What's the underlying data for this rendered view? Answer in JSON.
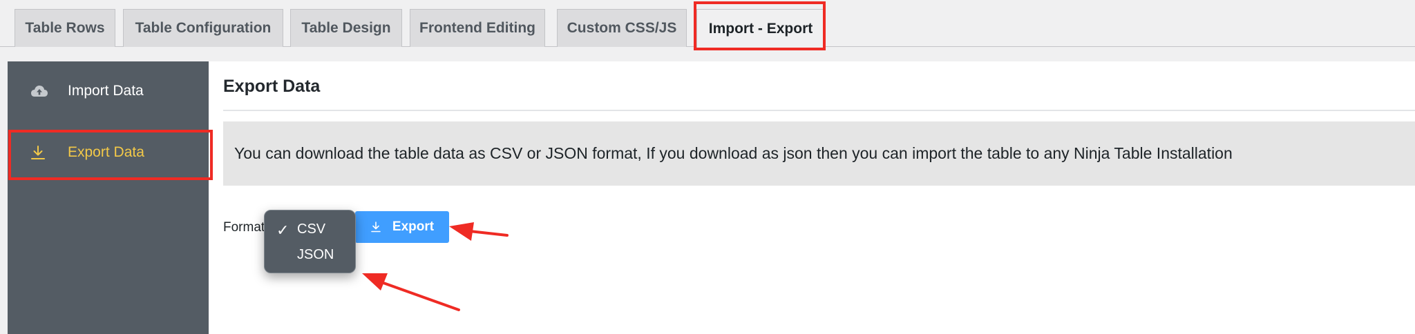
{
  "tabs": [
    {
      "label": "Table Rows"
    },
    {
      "label": "Table Configuration"
    },
    {
      "label": "Table Design"
    },
    {
      "label": "Frontend Editing"
    },
    {
      "label": "Custom CSS/JS"
    },
    {
      "label": "Import - Export",
      "active": true
    }
  ],
  "sidebar": {
    "items": [
      {
        "label": "Import Data",
        "icon": "cloud-upload-icon"
      },
      {
        "label": "Export Data",
        "icon": "download-icon",
        "active": true
      }
    ]
  },
  "main": {
    "title": "Export Data",
    "notice": "You can download the table data as CSV or JSON format, If you download as json then you can import the table to any Ninja Table Installation",
    "format_label": "Format",
    "export_button": "Export",
    "format_dropdown": {
      "selected": "CSV",
      "options": [
        "CSV",
        "JSON"
      ]
    }
  },
  "colors": {
    "accent": "#409eff",
    "sidebar_bg": "#545c64",
    "sidebar_active": "#f3c948",
    "highlight": "#ef2b24"
  }
}
